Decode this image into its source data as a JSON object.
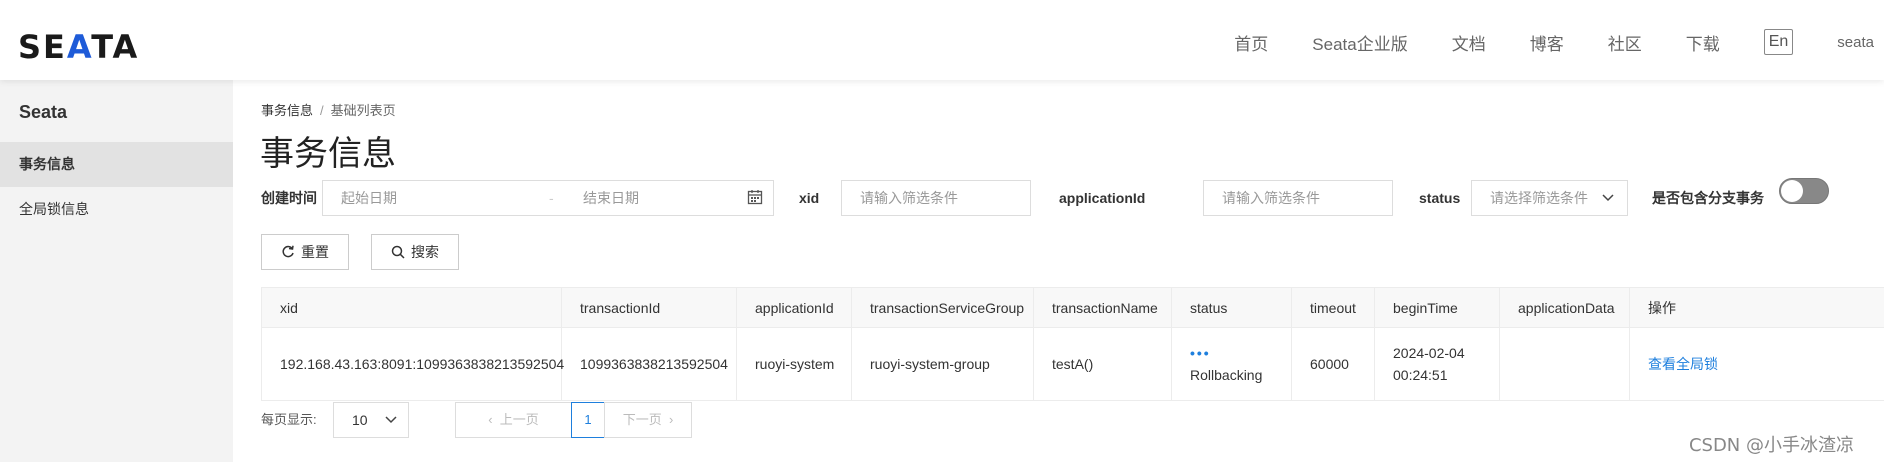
{
  "header": {
    "logo": {
      "part1": "SE",
      "accent": "A",
      "part2": "TA"
    },
    "nav": [
      "首页",
      "Seata企业版",
      "文档",
      "博客",
      "社区",
      "下载"
    ],
    "lang": "En",
    "user": "seata"
  },
  "sidebar": {
    "title": "Seata",
    "items": [
      {
        "label": "事务信息",
        "active": true
      },
      {
        "label": "全局锁信息",
        "active": false
      }
    ]
  },
  "breadcrumb": {
    "current": "事务信息",
    "separator": "/",
    "page": "基础列表页"
  },
  "page_title": "事务信息",
  "filters": {
    "created_label": "创建时间",
    "start_placeholder": "起始日期",
    "date_separator": "-",
    "end_placeholder": "结束日期",
    "xid_label": "xid",
    "xid_placeholder": "请输入筛选条件",
    "app_label": "applicationId",
    "app_placeholder": "请输入筛选条件",
    "status_label": "status",
    "status_placeholder": "请选择筛选条件",
    "branch_label": "是否包含分支事务",
    "branch_toggle_on": false
  },
  "buttons": {
    "reset": "重置",
    "search": "搜索"
  },
  "table": {
    "columns": [
      "xid",
      "transactionId",
      "applicationId",
      "transactionServiceGroup",
      "transactionName",
      "status",
      "timeout",
      "beginTime",
      "applicationData",
      "操作"
    ],
    "rows": [
      {
        "xid": "192.168.43.163:8091:1099363838213592504",
        "transactionId": "1099363838213592504",
        "applicationId": "ruoyi-system",
        "transactionServiceGroup": "ruoyi-system-group",
        "transactionName": "testA()",
        "status_dots": "•••",
        "status": "Rollbacking",
        "timeout": "60000",
        "beginTime_date": "2024-02-04",
        "beginTime_time": "00:24:51",
        "applicationData": "",
        "action": "查看全局锁"
      }
    ]
  },
  "pagination": {
    "label": "每页显示:",
    "page_size": "10",
    "prev": "上一页",
    "current": "1",
    "next": "下一页"
  },
  "watermark": "CSDN @小手冰渣凉",
  "colors": {
    "accent": "#1e7fdd",
    "logo_accent": "#1e5bd8",
    "sidebar_bg": "#f3f3f3",
    "active_bg": "#e2e2e2"
  }
}
